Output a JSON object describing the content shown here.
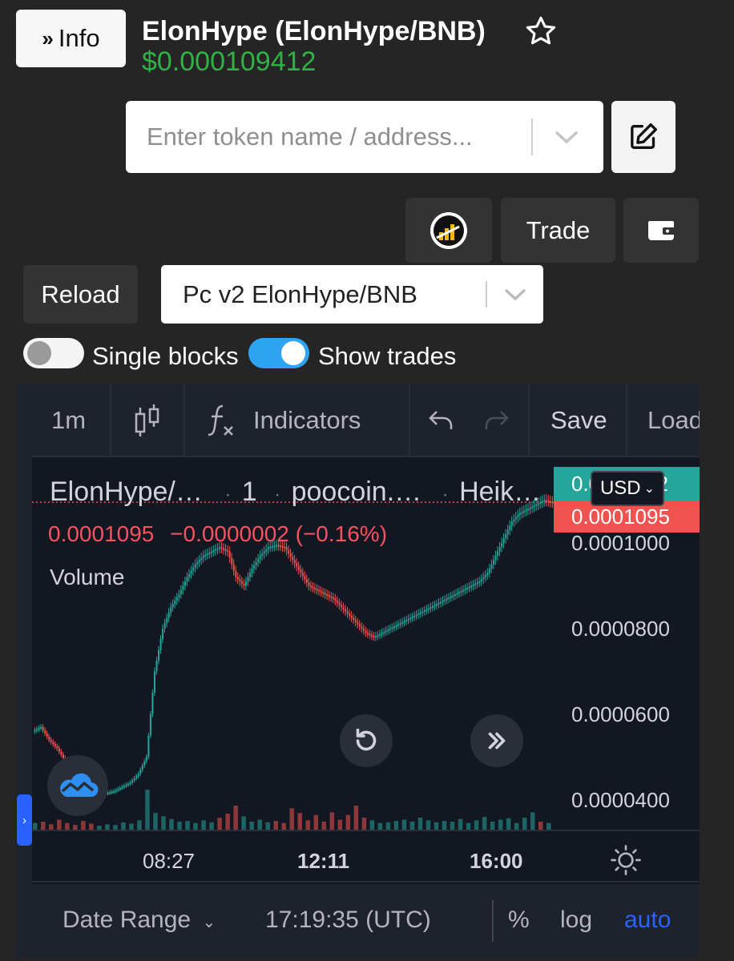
{
  "header": {
    "info_label": "Info",
    "token_title": "ElonHype (ElonHype/BNB)",
    "price": "$0.000109412"
  },
  "search": {
    "placeholder": "Enter token name / address..."
  },
  "actions": {
    "trade_label": "Trade",
    "reload_label": "Reload"
  },
  "pair_select": {
    "selected": "Pc v2 ElonHype/BNB"
  },
  "toggles": {
    "single_blocks": {
      "label": "Single blocks",
      "on": false
    },
    "show_trades": {
      "label": "Show trades",
      "on": true
    }
  },
  "chart_widget": {
    "toolbar": {
      "interval": "1m",
      "indicators": "Indicators",
      "save": "Save",
      "load": "Load"
    },
    "legend": {
      "symbol": "ElonHype/…",
      "interval": "1",
      "source": "poocoin.…",
      "style": "Heik…",
      "dot": "·",
      "last": "0.0001095",
      "change": "−0.0000002 (−0.16%)"
    },
    "volume_label": "Volume",
    "price_tag_top": "0.0001132",
    "price_tag_bottom": "0.0001095",
    "currency": "USD",
    "colors": {
      "up": "#26a69a",
      "down": "#ef5350",
      "background": "#131722"
    },
    "bottom": {
      "date_range": "Date Range",
      "time": "17:19:35 (UTC)",
      "percent": "%",
      "log": "log",
      "auto": "auto"
    }
  },
  "chart_data": {
    "type": "candlestick",
    "y_ticks": [
      "0.0001000",
      "0.0000800",
      "0.0000600",
      "0.0000400"
    ],
    "y_tick_values": [
      0.0001,
      8e-05,
      6e-05,
      4e-05
    ],
    "x_ticks": [
      "08:27",
      "12:11",
      "16:00"
    ],
    "ylim": [
      3.3e-05,
      0.00012
    ],
    "last_price": 0.0001095,
    "close_path": [
      5.6e-05,
      5.7e-05,
      5.4e-05,
      5.2e-05,
      4.9e-05,
      4.6e-05,
      4.4e-05,
      4.2e-05,
      4.1e-05,
      4.15e-05,
      4.2e-05,
      4.3e-05,
      4.4e-05,
      4.6e-05,
      5e-05,
      7e-05,
      8e-05,
      8.5e-05,
      8.8e-05,
      9.2e-05,
      9.5e-05,
      9.7e-05,
      9.8e-05,
      9.9e-05,
      9.8e-05,
      9.2e-05,
      9e-05,
      9.4e-05,
      9.7e-05,
      9.9e-05,
      9.95e-05,
      9.9e-05,
      9.6e-05,
      9.3e-05,
      9e-05,
      8.9e-05,
      8.8e-05,
      8.7e-05,
      8.5e-05,
      8.3e-05,
      8.1e-05,
      7.9e-05,
      7.8e-05,
      7.9e-05,
      8e-05,
      8.1e-05,
      8.2e-05,
      8.3e-05,
      8.4e-05,
      8.5e-05,
      8.6e-05,
      8.7e-05,
      8.8e-05,
      8.9e-05,
      9e-05,
      9.1e-05,
      9.3e-05,
      9.7e-05,
      0.000101,
      0.000105,
      0.000107,
      0.000108,
      0.000109,
      0.00011,
      0.0001095
    ],
    "volumes": [
      1,
      1.2,
      0.8,
      1.5,
      1,
      0.7,
      1.3,
      0.9,
      0.6,
      0.8,
      0.7,
      1.1,
      0.9,
      1.4,
      6,
      2.5,
      2,
      1.6,
      1.2,
      1.3,
      1,
      1.4,
      1.1,
      1.8,
      2.4,
      3.6,
      2,
      1.2,
      1.5,
      1.1,
      1.3,
      1,
      3.2,
      2.5,
      1.4,
      2.2,
      1.2,
      2.6,
      1.5,
      2.2,
      3.6,
      1.8,
      1.4,
      1,
      1.1,
      1.3,
      1.5,
      1.2,
      1.8,
      1.4,
      1.1,
      1.3,
      1.2,
      1.6,
      1,
      1.4,
      1.9,
      1.2,
      1.5,
      1.7,
      1,
      1.8,
      2.6,
      1.2,
      1
    ]
  }
}
